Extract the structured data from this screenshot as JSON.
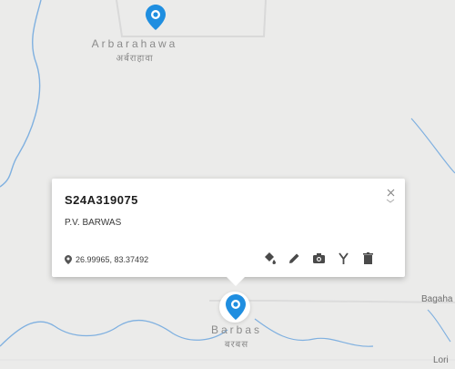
{
  "map": {
    "places": [
      {
        "name_en": "Arbarahawa",
        "name_hi": "अर्बराहावा"
      },
      {
        "name_en": "Barbas",
        "name_hi": "बरबस"
      }
    ],
    "road_labels": [
      "Bagaha",
      "Lori"
    ],
    "colors": {
      "marker": "#1f8ee0",
      "map_bg": "#ebebea",
      "water": "#7fb0e0"
    }
  },
  "popup": {
    "site_id": "S24A319075",
    "site_name": "P.V. BARWAS",
    "coordinates": "26.99965, 83.37492",
    "close_icon": "close-icon",
    "tools": [
      "paint-bucket-icon",
      "pencil-icon",
      "camera-icon",
      "fork-icon",
      "trash-icon"
    ]
  }
}
